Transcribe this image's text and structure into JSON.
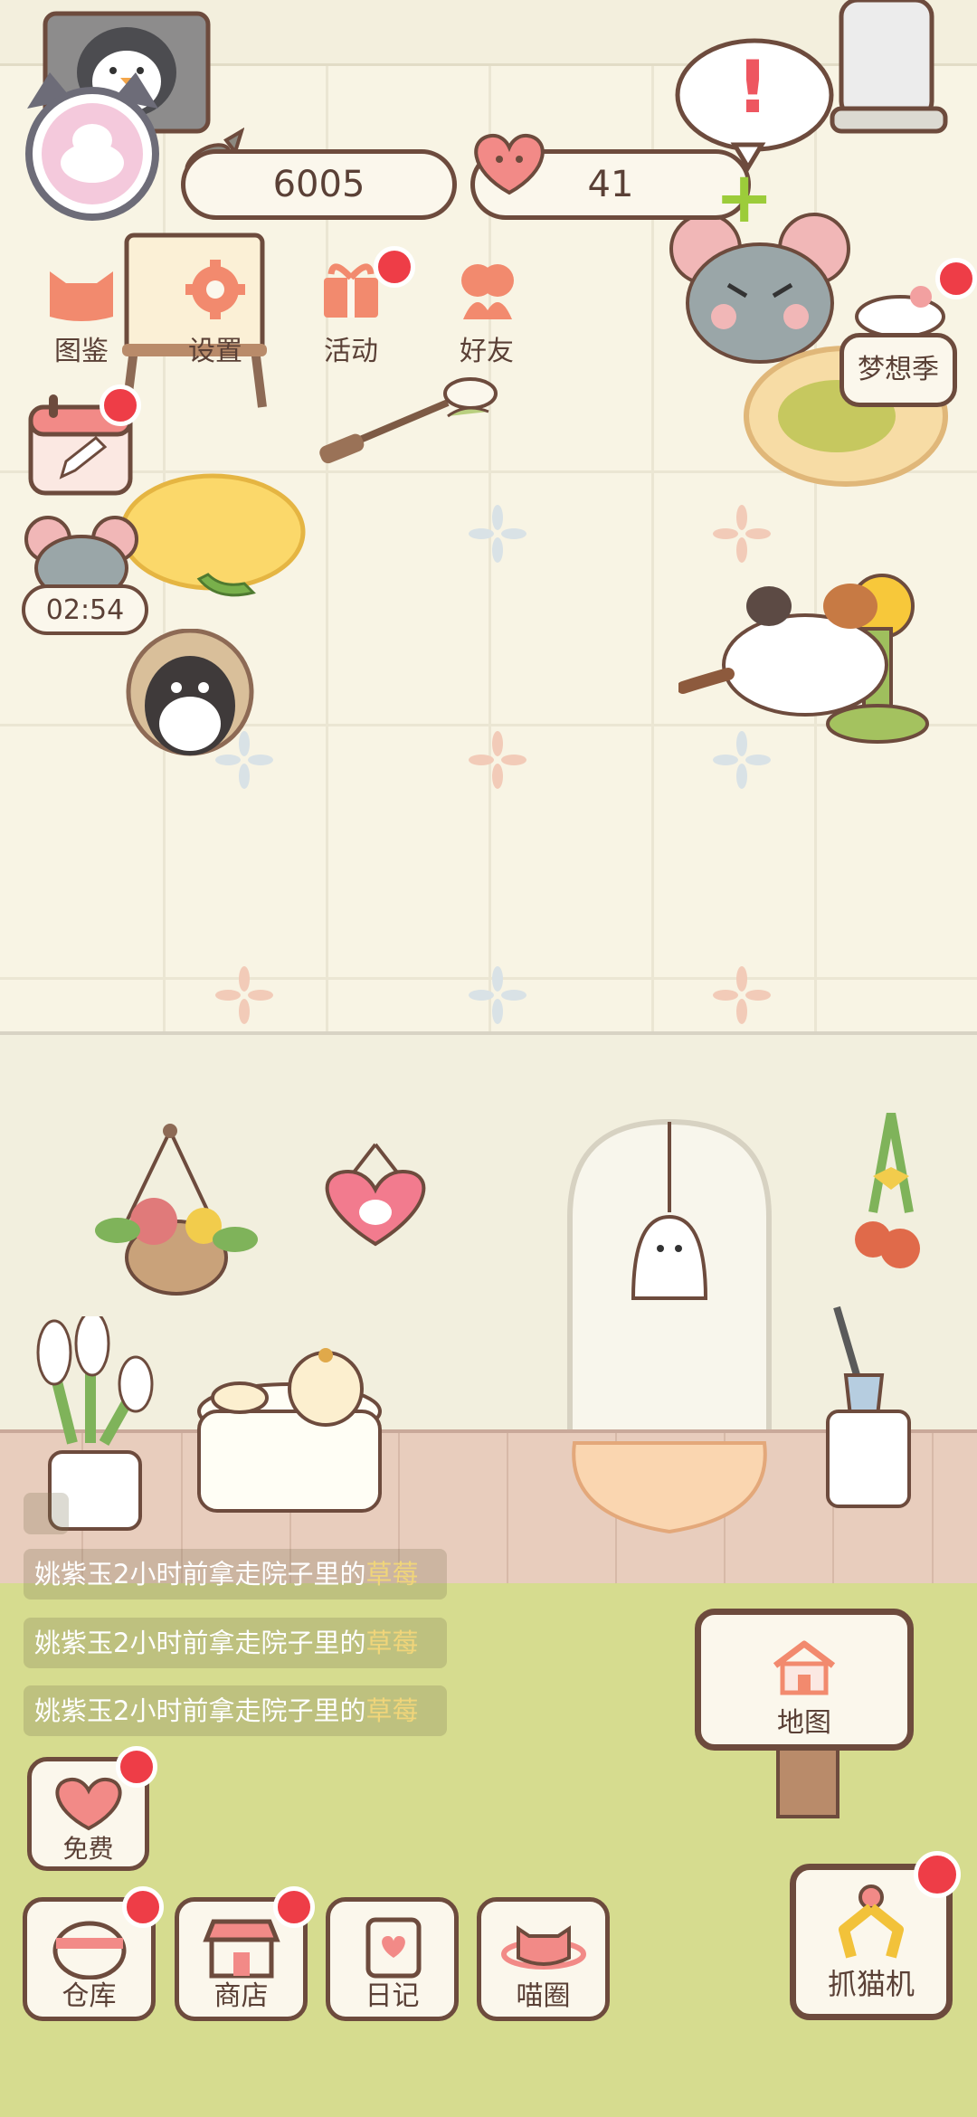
{
  "hud": {
    "fish_count": "6005",
    "heart_count": "41",
    "alert_mark": "!",
    "plus": "+"
  },
  "menu": [
    {
      "label": "图鉴",
      "icon": "cat-face-icon"
    },
    {
      "label": "设置",
      "icon": "gear-icon"
    },
    {
      "label": "活动",
      "icon": "gift-icon"
    },
    {
      "label": "好友",
      "icon": "friends-icon"
    }
  ],
  "dream_season": {
    "label": "梦想季"
  },
  "timer": {
    "value": "02:54"
  },
  "toasts": [
    {
      "prefix": "姚紫玉2小时前拿走院子里的",
      "item": "草莓"
    },
    {
      "prefix": "姚紫玉2小时前拿走院子里的",
      "item": "草莓"
    },
    {
      "prefix": "姚紫玉2小时前拿走院子里的",
      "item": "草莓"
    }
  ],
  "map": {
    "label": "地图"
  },
  "free": {
    "label": "免费"
  },
  "bottom_bar": [
    {
      "label": "仓库",
      "icon": "storage-icon"
    },
    {
      "label": "商店",
      "icon": "shop-icon"
    },
    {
      "label": "日记",
      "icon": "diary-icon"
    },
    {
      "label": "喵圈",
      "icon": "cat-planet-icon"
    }
  ],
  "claw": {
    "label": "抓猫机"
  },
  "colors": {
    "red_dot": "#ee3d47",
    "border_brown": "#6d4b3d",
    "highlight_yellow": "#f0d57a",
    "plus_green": "#9ccc3a"
  }
}
